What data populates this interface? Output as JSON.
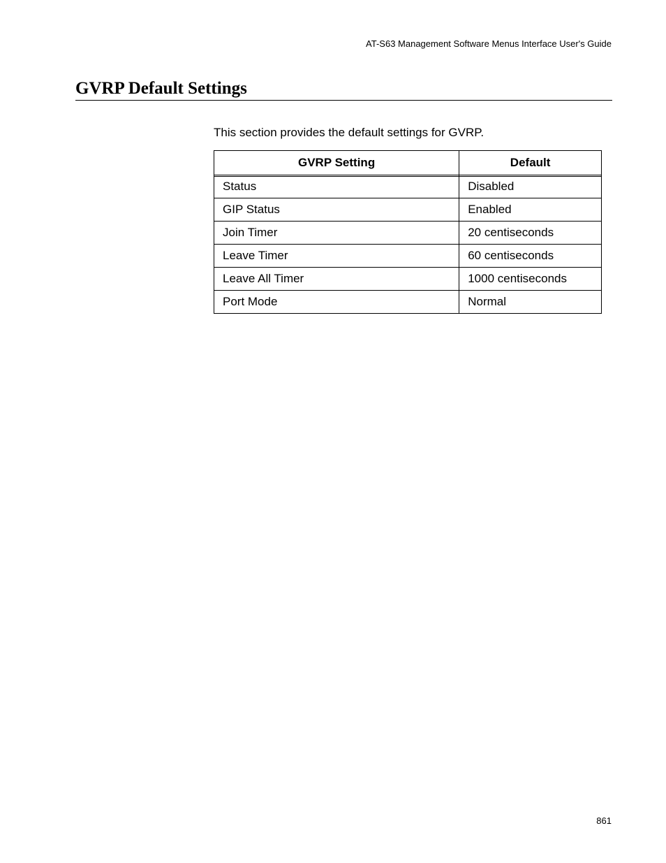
{
  "header": {
    "guide_title": "AT-S63 Management Software Menus Interface User's Guide"
  },
  "section": {
    "title": "GVRP Default Settings",
    "intro": "This section provides the default settings for GVRP."
  },
  "table": {
    "headers": {
      "setting": "GVRP Setting",
      "default": "Default"
    },
    "rows": [
      {
        "setting": "Status",
        "default": "Disabled"
      },
      {
        "setting": "GIP Status",
        "default": "Enabled"
      },
      {
        "setting": "Join Timer",
        "default": "20 centiseconds"
      },
      {
        "setting": "Leave Timer",
        "default": "60 centiseconds"
      },
      {
        "setting": "Leave All Timer",
        "default": "1000 centiseconds"
      },
      {
        "setting": "Port Mode",
        "default": "Normal"
      }
    ]
  },
  "footer": {
    "page_number": "861"
  }
}
